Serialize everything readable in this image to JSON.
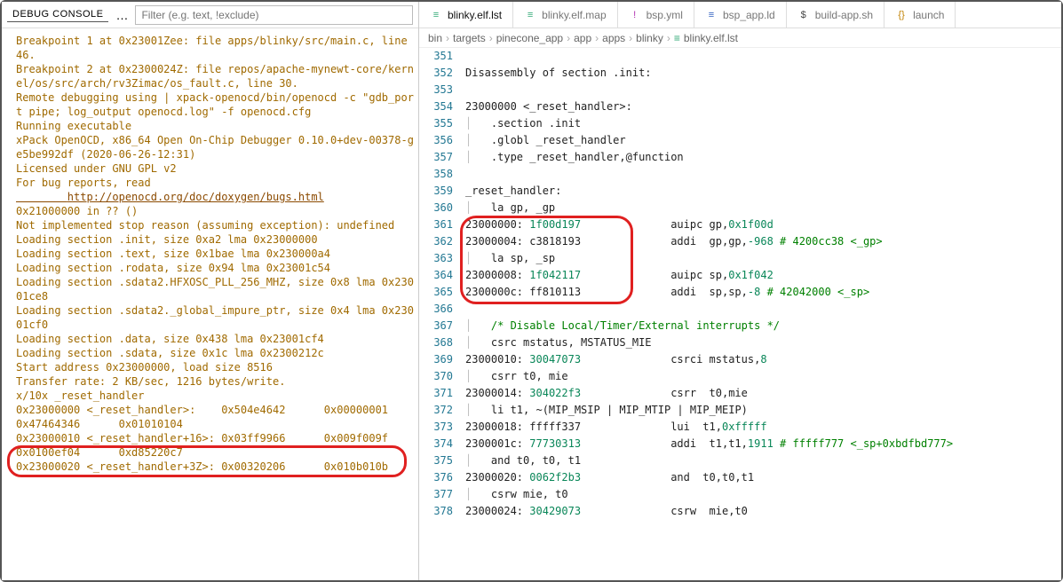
{
  "debug_console": {
    "title": "Debug Console",
    "dots": "…",
    "filter_placeholder": "Filter (e.g. text, !exclude)",
    "lines": [
      {
        "t": "Breakpoint 1 at 0x23001Zee: file apps/blinky/src/main.c, line 46.",
        "c": "c-orange"
      },
      {
        "t": "Breakpoint 2 at 0x2300024Z: file repos/apache-mynewt-core/kernel/os/src/arch/rv3Zimac/os_fault.c, line 30.",
        "c": "c-orange"
      },
      {
        "t": "Remote debugging using | xpack-openocd/bin/openocd -c \"gdb_port pipe; log_output openocd.log\" -f openocd.cfg",
        "c": "c-orange"
      },
      {
        "t": "Running executable",
        "c": "c-orange"
      },
      {
        "t": "xPack OpenOCD, x86_64 Open On-Chip Debugger 0.10.0+dev-00378-ge5be992df (2020-06-26-12:31)",
        "c": "c-orange"
      },
      {
        "t": "Licensed under GNU GPL v2",
        "c": "c-orange"
      },
      {
        "t": "For bug reports, read",
        "c": "c-orange"
      },
      {
        "t": "        http://openocd.org/doc/doxygen/bugs.html",
        "c": "c-link"
      },
      {
        "t": "0x21000000 in ?? ()",
        "c": "c-orange"
      },
      {
        "t": "Not implemented stop reason (assuming exception): undefined",
        "c": "c-orange"
      },
      {
        "t": "Loading section .init, size 0xa2 lma 0x23000000",
        "c": "c-orange"
      },
      {
        "t": "Loading section .text, size 0x1bae lma 0x230000a4",
        "c": "c-orange"
      },
      {
        "t": "Loading section .rodata, size 0x94 lma 0x23001c54",
        "c": "c-orange"
      },
      {
        "t": "Loading section .sdata2.HFXOSC_PLL_256_MHZ, size 0x8 lma 0x23001ce8",
        "c": "c-orange"
      },
      {
        "t": "Loading section .sdata2._global_impure_ptr, size 0x4 lma 0x23001cf0",
        "c": "c-orange"
      },
      {
        "t": "Loading section .data, size 0x438 lma 0x23001cf4",
        "c": "c-orange"
      },
      {
        "t": "Loading section .sdata, size 0x1c lma 0x2300212c",
        "c": "c-orange"
      },
      {
        "t": "Start address 0x23000000, load size 8516",
        "c": "c-orange"
      },
      {
        "t": "Transfer rate: 2 KB/sec, 1216 bytes/write.",
        "c": "c-orange"
      },
      {
        "t": "x/10x _reset_handler",
        "c": "c-orange"
      },
      {
        "t": "0x23000000 <_reset_handler>:    0x504e4642      0x00000001      0x47464346      0x01010104",
        "c": "c-orange hl"
      },
      {
        "t": "0x23000010 <_reset_handler+16>: 0x03ff9966      0x009f009f      0x0100ef04      0xd85220c7",
        "c": "c-orange"
      },
      {
        "t": "0x23000020 <_reset_handler+3Z>: 0x00320206      0x010b010b",
        "c": "c-orange"
      }
    ]
  },
  "tabs": [
    {
      "label": "blinky.elf.lst",
      "icon": "≡",
      "icls": "ico-file",
      "active": true
    },
    {
      "label": "blinky.elf.map",
      "icon": "≡",
      "icls": "ico-file"
    },
    {
      "label": "bsp.yml",
      "icon": "!",
      "icls": "ico-yml"
    },
    {
      "label": "bsp_app.ld",
      "icon": "≡",
      "icls": "ico-ld"
    },
    {
      "label": "build-app.sh",
      "icon": "$",
      "icls": "ico-sh"
    },
    {
      "label": "launch",
      "icon": "{}",
      "icls": "ico-json"
    }
  ],
  "breadcrumb": [
    "bin",
    "targets",
    "pinecone_app",
    "app",
    "apps",
    "blinky",
    "blinky.elf.lst"
  ],
  "code": {
    "start": 351,
    "lines": [
      {
        "n": 351,
        "html": ""
      },
      {
        "n": 352,
        "html": "<span class='c-black'>Disassembly of section .init:</span>"
      },
      {
        "n": 353,
        "html": ""
      },
      {
        "n": 354,
        "html": "<span class='c-black'>23000000 &lt;_reset_handler&gt;:</span>"
      },
      {
        "n": 355,
        "html": "<span class='c-ghost'>│   </span><span class='c-black'>.section .init</span>"
      },
      {
        "n": 356,
        "html": "<span class='c-ghost'>│   </span><span class='c-black'>.globl _reset_handler</span>"
      },
      {
        "n": 357,
        "html": "<span class='c-ghost'>│   </span><span class='c-black'>.type _reset_handler,@function</span>"
      },
      {
        "n": 358,
        "html": ""
      },
      {
        "n": 359,
        "html": "<span class='c-black'>_reset_handler:</span>"
      },
      {
        "n": 360,
        "html": "<span class='c-ghost'>│   </span><span class='c-black'>la gp, _gp</span>"
      },
      {
        "n": 361,
        "html": "<span class='c-black'>23000000:</span> <span class='c-num'>1f00d197</span>          \t<span class='c-black'>auipc gp,</span><span class='c-num'>0x1f00d</span>"
      },
      {
        "n": 362,
        "html": "<span class='c-black'>23000004:</span> <span class='c-black'>c3818193</span>          \t<span class='c-black'>addi  gp,gp,</span><span class='c-num'>-968</span> <span class='c-green'># 4200cc38 &lt;_gp&gt;</span>"
      },
      {
        "n": 363,
        "html": "<span class='c-ghost'>│   </span><span class='c-black'>la sp, _sp</span>"
      },
      {
        "n": 364,
        "html": "<span class='c-black'>23000008:</span> <span class='c-num'>1f042117</span>          \t<span class='c-black'>auipc sp,</span><span class='c-num'>0x1f042</span>"
      },
      {
        "n": 365,
        "html": "<span class='c-black'>2300000c:</span> <span class='c-black'>ff810113</span>          \t<span class='c-black'>addi  sp,sp,</span><span class='c-num'>-8</span> <span class='c-green'># 42042000 &lt;_sp&gt;</span>"
      },
      {
        "n": 366,
        "html": ""
      },
      {
        "n": 367,
        "html": "<span class='c-ghost'>│   </span><span class='c-green'>/* Disable Local/Timer/External interrupts */</span>"
      },
      {
        "n": 368,
        "html": "<span class='c-ghost'>│   </span><span class='c-black'>csrc mstatus, MSTATUS_MIE</span>"
      },
      {
        "n": 369,
        "html": "<span class='c-black'>23000010:</span> <span class='c-num'>30047073</span>          \t<span class='c-black'>csrci mstatus,</span><span class='c-num'>8</span>"
      },
      {
        "n": 370,
        "html": "<span class='c-ghost'>│   </span><span class='c-black'>csrr t0, mie</span>"
      },
      {
        "n": 371,
        "html": "<span class='c-black'>23000014:</span> <span class='c-num'>304022f3</span>          \t<span class='c-black'>csrr  t0,mie</span>"
      },
      {
        "n": 372,
        "html": "<span class='c-ghost'>│   </span><span class='c-black'>li t1, ~(MIP_MSIP | MIP_MTIP | MIP_MEIP)</span>"
      },
      {
        "n": 373,
        "html": "<span class='c-black'>23000018:</span> <span class='c-black'>fffff337</span>          \t<span class='c-black'>lui  t1,</span><span class='c-num'>0xfffff</span>"
      },
      {
        "n": 374,
        "html": "<span class='c-black'>2300001c:</span> <span class='c-num'>77730313</span>          \t<span class='c-black'>addi  t1,t1,</span><span class='c-num'>1911</span> <span class='c-green'># fffff777 &lt;_sp+0xbdfbd777&gt;</span>"
      },
      {
        "n": 375,
        "html": "<span class='c-ghost'>│   </span><span class='c-black'>and t0, t0, t1</span>"
      },
      {
        "n": 376,
        "html": "<span class='c-black'>23000020:</span> <span class='c-num'>0062f2b3</span>          \t<span class='c-black'>and  t0,t0,t1</span>"
      },
      {
        "n": 377,
        "html": "<span class='c-ghost'>│   </span><span class='c-black'>csrw mie, t0</span>"
      },
      {
        "n": 378,
        "html": "<span class='c-black'>23000024:</span> <span class='c-num'>30429073</span>          \t<span class='c-black'>csrw  mie,t0</span>"
      }
    ]
  }
}
